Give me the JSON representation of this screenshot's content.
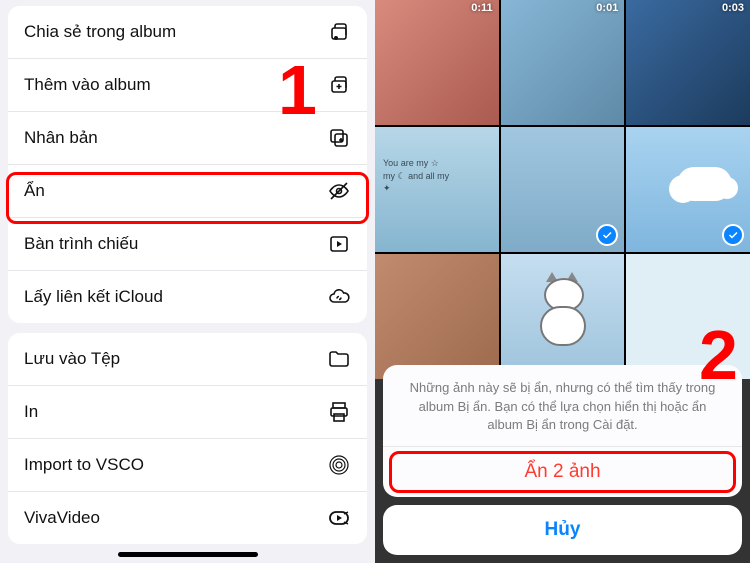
{
  "annotations": {
    "step1": "1",
    "step2": "2"
  },
  "menu": {
    "group1": [
      {
        "label": "Chia sẻ trong album",
        "icon": "album-share-icon"
      },
      {
        "label": "Thêm vào album",
        "icon": "album-add-icon"
      },
      {
        "label": "Nhân bản",
        "icon": "duplicate-icon"
      },
      {
        "label": "Ẩn",
        "icon": "hide-icon",
        "highlighted": true
      },
      {
        "label": "Bàn trình chiếu",
        "icon": "slideshow-icon"
      },
      {
        "label": "Lấy liên kết iCloud",
        "icon": "icloud-link-icon"
      }
    ],
    "group2": [
      {
        "label": "Lưu vào Tệp",
        "icon": "folder-icon"
      },
      {
        "label": "In",
        "icon": "print-icon"
      },
      {
        "label": "Import to VSCO",
        "icon": "vsco-icon"
      },
      {
        "label": "VivaVideo",
        "icon": "vivavideo-icon"
      }
    ]
  },
  "grid": {
    "durations": [
      "0:11",
      "0:01",
      "0:03"
    ],
    "quote_line1": "You are my ☆",
    "quote_line2": "my ☾ and all my",
    "quote_line3": "✦",
    "selected": [
      4,
      5
    ]
  },
  "sheet": {
    "message": "Những ảnh này sẽ bị ẩn, nhưng có thể tìm thấy trong album Bị ẩn. Bạn có thể lựa chọn hiển thị hoặc ẩn album Bị ẩn trong Cài đặt.",
    "action": "Ẩn 2 ảnh",
    "cancel": "Hủy"
  }
}
